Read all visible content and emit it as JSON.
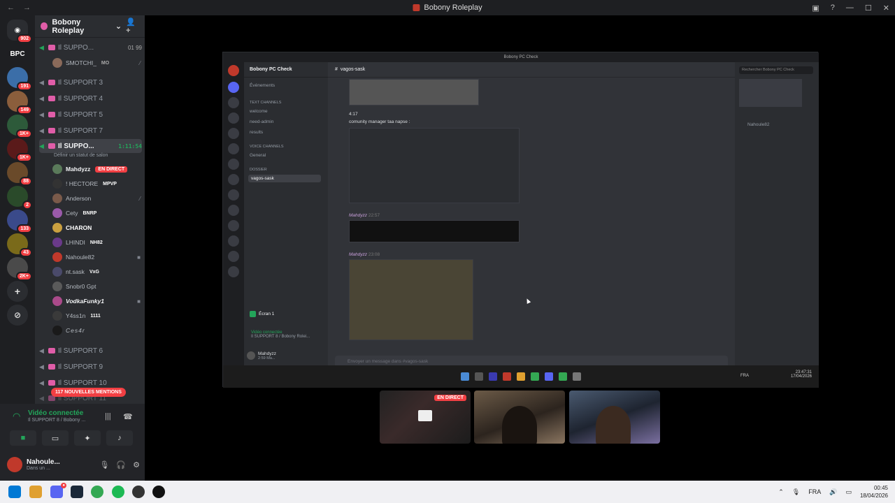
{
  "window": {
    "title": "Bobony Roleplay"
  },
  "servers": [
    {
      "label": "",
      "badge": "902"
    },
    {
      "label": "BPC",
      "badge": ""
    },
    {
      "label": "",
      "badge": "191"
    },
    {
      "label": "",
      "badge": "149"
    },
    {
      "label": "",
      "badge": "1K+"
    },
    {
      "label": "",
      "badge": "1K+"
    },
    {
      "label": "",
      "badge": "88"
    },
    {
      "label": "",
      "badge": "2"
    },
    {
      "label": "",
      "badge": "133"
    },
    {
      "label": "",
      "badge": "43"
    },
    {
      "label": "",
      "badge": "2K+"
    }
  ],
  "guild": {
    "name": "Bobony Roleplay"
  },
  "channels": {
    "support_top": {
      "name": "Il SUPPO...",
      "count": "01",
      "limit": "99"
    },
    "smotchi": {
      "name": "SMOTCHI_",
      "tag": "MO"
    },
    "support3": "Il SUPPORT 3",
    "support4": "Il SUPPORT 4",
    "support5": "Il SUPPORT 5",
    "support7": "Il SUPPORT 7",
    "active": {
      "name": "Il SUPPO...",
      "timer": "1:11:54",
      "status": "Définir un statut de salon"
    },
    "support6": "Il SUPPORT 6",
    "support9": "Il SUPPORT 9",
    "support10": "Il SUPPORT 10",
    "support11": "Il SUPPORT 11"
  },
  "members": [
    {
      "name": "Mahdyzz",
      "live": "EN DIRECT",
      "badge": ""
    },
    {
      "name": "! HECTORE",
      "live": "",
      "badge": "MPVP"
    },
    {
      "name": "Anderson",
      "live": "",
      "badge": ""
    },
    {
      "name": "Cety",
      "live": "",
      "badge": "BNRP"
    },
    {
      "name": "CHARON",
      "live": "",
      "badge": ""
    },
    {
      "name": "LHINDI",
      "live": "",
      "badge": "NH82"
    },
    {
      "name": "Nahoule82",
      "live": "",
      "badge": ""
    },
    {
      "name": "nt.sask",
      "live": "",
      "badge": "VxG"
    },
    {
      "name": "Snobr0 Gpt",
      "live": "",
      "badge": ""
    },
    {
      "name": "VodkaFunky1",
      "live": "",
      "badge": ""
    },
    {
      "name": "Y4ss1n",
      "live": "",
      "badge": "1111"
    },
    {
      "name": "Ces4r",
      "live": "",
      "badge": ""
    }
  ],
  "mentions": "117 NOUVELLES MENTIONS",
  "voice": {
    "title": "Vidéo connectée",
    "channel": "Il SUPPORT 8 / Bobony ..."
  },
  "user": {
    "name": "Nahoule...",
    "status": "Dans un ..."
  },
  "screenshare": {
    "title": "Bobony PC Check",
    "server": "Bobony PC Check",
    "events": "Événements",
    "text_cat": "Text channels",
    "text_channels": [
      "welcome",
      "need-admin",
      "results"
    ],
    "voice_cat": "Voice channels",
    "voice_channels": [
      "General"
    ],
    "folder": "DOSSIER",
    "folder_channels": [
      "vagos-sask"
    ],
    "current_channel": "vagos-sask",
    "search": "Rechercher Bobony PC Check",
    "msg_time": "4:17",
    "msg_text": "comunity manager taa napse :",
    "author1": "Mahdyzz",
    "time1": "22:57",
    "author2": "Mahdyzz",
    "time2": "23:08",
    "input_placeholder": "Envoyer un message dans #vagos-sask",
    "member": "Nahoule82",
    "screen_label": "Écran 1",
    "vc_label": "Vidéo connectée",
    "vc_sub": "Il SUPPORT 8 / Bobony Rolei...",
    "me": "Mahdyzz",
    "me_status": "2:59 Ma...",
    "lang": "FRA",
    "clock_time": "23:47:31",
    "clock_date": "17/04/2026"
  },
  "tiles": {
    "live": "EN DIRECT"
  },
  "taskbar": {
    "lang": "FRA",
    "time": "00:45",
    "date": "18/04/2026"
  }
}
